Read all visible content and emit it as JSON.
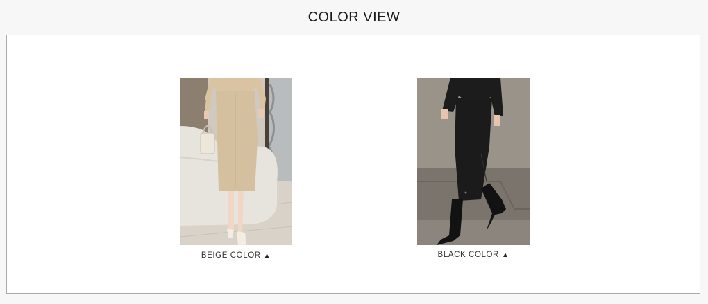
{
  "header": {
    "title": "COLOR VIEW"
  },
  "products": [
    {
      "label": "BEIGE COLOR",
      "arrow_icon": "triangle-up-icon",
      "color": "#d4bf9f"
    },
    {
      "label": "BLACK COLOR",
      "arrow_icon": "triangle-up-icon",
      "color": "#1b1b1b"
    }
  ]
}
